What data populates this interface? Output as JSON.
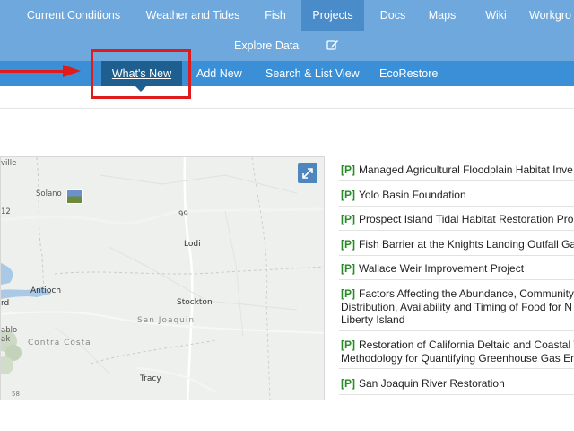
{
  "topnav": {
    "items": [
      {
        "label": "Current Conditions"
      },
      {
        "label": "Weather and Tides"
      },
      {
        "label": "Fish"
      },
      {
        "label": "Projects",
        "active": true
      },
      {
        "label": "Docs"
      },
      {
        "label": "Maps"
      },
      {
        "label": "Wiki"
      },
      {
        "label": "Workgro"
      }
    ],
    "explore_label": "Explore Data",
    "edit_icon": "pencil-square-icon"
  },
  "subnav": {
    "items": [
      {
        "label": "What's New",
        "active": true
      },
      {
        "label": "Add New"
      },
      {
        "label": "Search & List View"
      },
      {
        "label": "EcoRestore"
      }
    ]
  },
  "annotation": {
    "color": "#e01b1b"
  },
  "map": {
    "expand_icon": "expand-arrows-icon",
    "labels": {
      "ville": "ville",
      "solano": "Solano",
      "n12": "12",
      "n99": "99",
      "lodi": "Lodi",
      "antioch": "Antioch",
      "rd": "rd",
      "stockton": "Stockton",
      "san_joaquin": "San Joaquin",
      "contra_costa": "Contra Costa",
      "ablo": "ablo",
      "ak": "ak",
      "tracy": "Tracy",
      "scale": "58"
    }
  },
  "projects": {
    "tag": "[P]",
    "items": [
      {
        "lines": [
          "Managed Agricultural Floodplain Habitat Inve"
        ]
      },
      {
        "lines": [
          "Yolo Basin Foundation"
        ]
      },
      {
        "lines": [
          "Prospect Island Tidal Habitat Restoration Pro"
        ]
      },
      {
        "lines": [
          "Fish Barrier at the Knights Landing Outfall Ga"
        ]
      },
      {
        "lines": [
          "Wallace Weir Improvement Project"
        ]
      },
      {
        "lines": [
          "Factors Affecting the Abundance, Community",
          "Distribution, Availability and Timing of Food for N",
          "Liberty Island"
        ]
      },
      {
        "lines": [
          "Restoration of California Deltaic and Coastal W",
          "Methodology for Quantifying Greenhouse Gas Em"
        ]
      },
      {
        "lines": [
          "San Joaquin River Restoration"
        ]
      }
    ]
  },
  "colors": {
    "nav_bg": "#6ea8dd",
    "nav_active": "#4a8bc9",
    "subnav_bg": "#3a8fd6",
    "subnav_active": "#1f5f8f",
    "tag_green": "#2a8a2a"
  }
}
